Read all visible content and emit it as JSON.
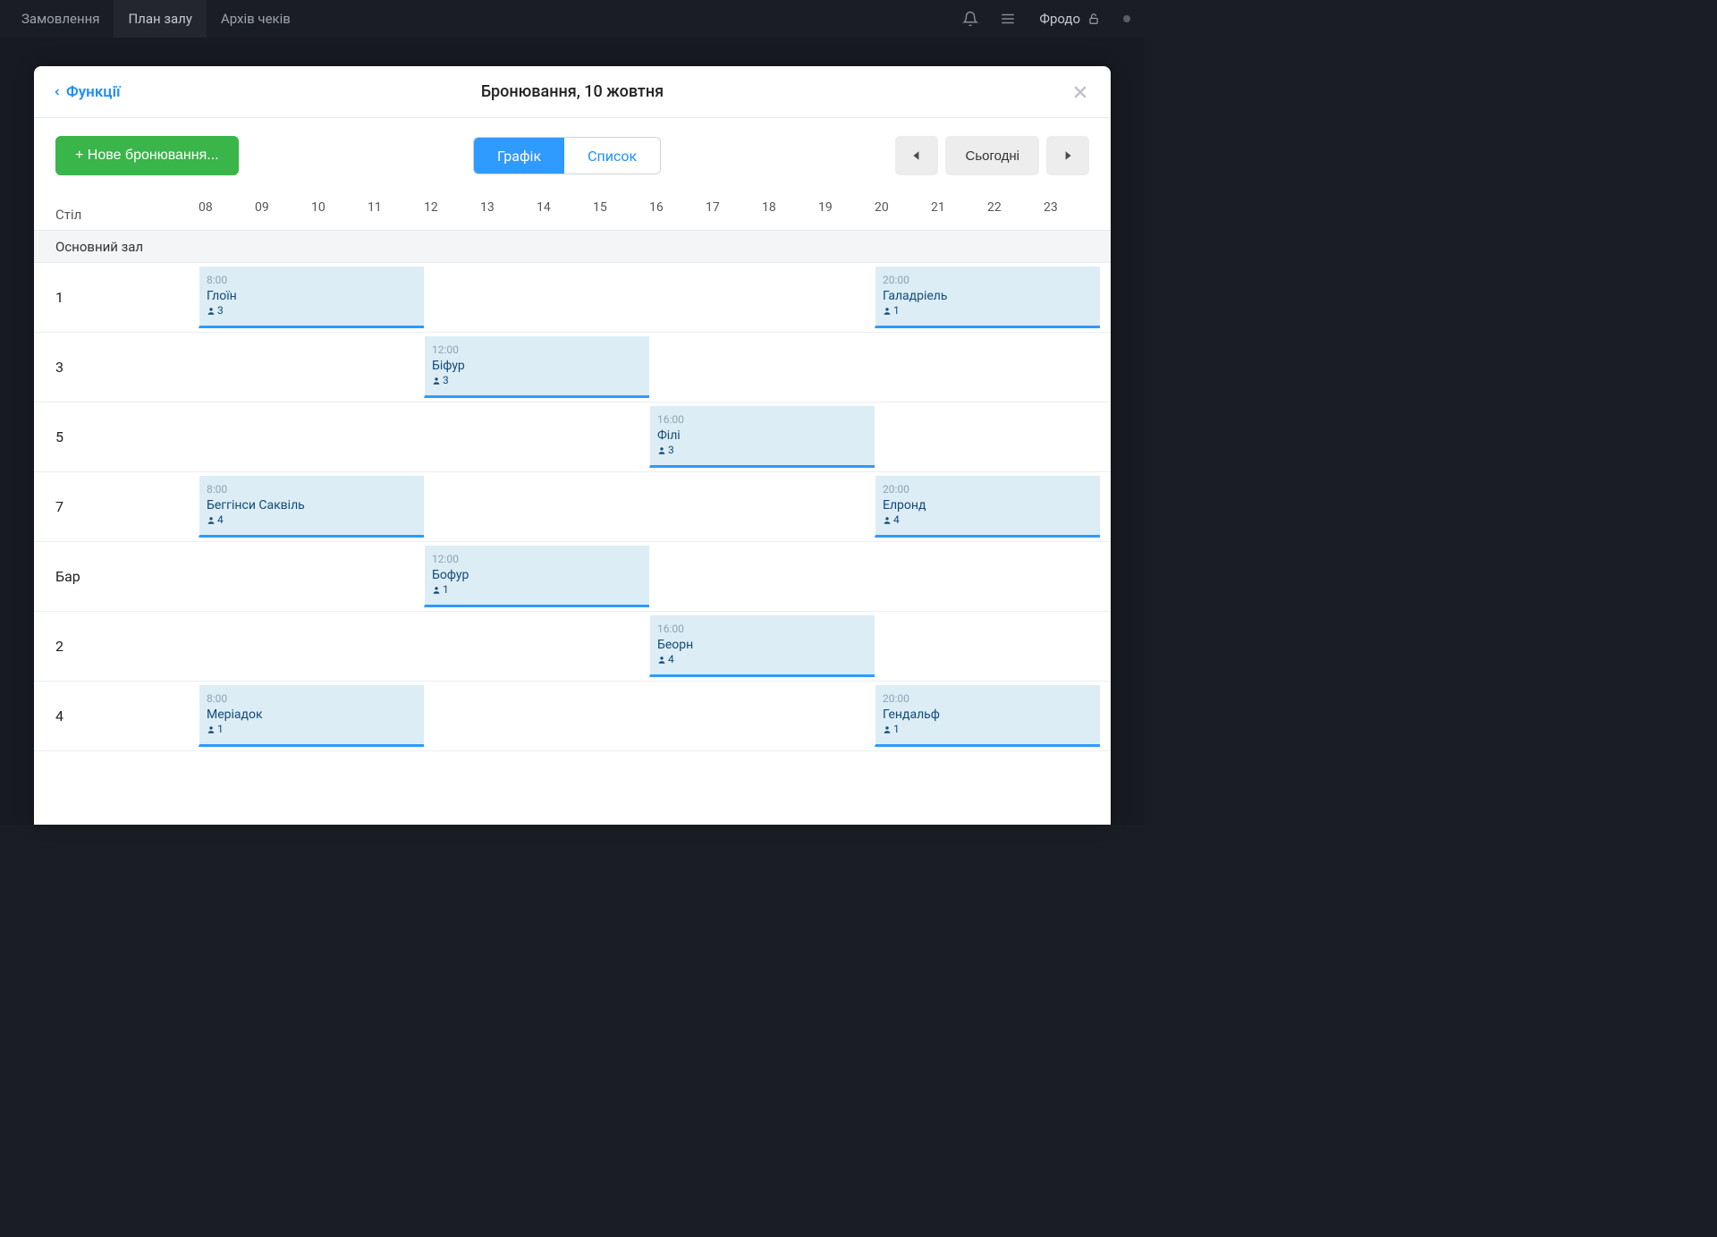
{
  "topbar": {
    "items": [
      "Замовлення",
      "План залу",
      "Архів чеків"
    ],
    "activeIndex": 1,
    "user": "Фродо"
  },
  "modal": {
    "backLabel": "Функції",
    "title": "Бронювання, 10 жовтня",
    "newBookingLabel": "+ Нове бронювання...",
    "segments": {
      "chart": "Графік",
      "list": "Список"
    },
    "todayLabel": "Сьогодні",
    "tableColumnLabel": "Стіл"
  },
  "timeline": {
    "startHour": 8,
    "endHour": 24,
    "hours": [
      "08",
      "09",
      "10",
      "11",
      "12",
      "13",
      "14",
      "15",
      "16",
      "17",
      "18",
      "19",
      "20",
      "21",
      "22",
      "23"
    ]
  },
  "section": {
    "name": "Основний зал"
  },
  "rows": [
    {
      "table": "1",
      "bookings": [
        {
          "time": "8:00",
          "startHour": 8,
          "durationHours": 4,
          "name": "Глоїн",
          "guests": 3
        },
        {
          "time": "20:00",
          "startHour": 20,
          "durationHours": 4,
          "name": "Галадріель",
          "guests": 1
        }
      ]
    },
    {
      "table": "3",
      "bookings": [
        {
          "time": "12:00",
          "startHour": 12,
          "durationHours": 4,
          "name": "Біфур",
          "guests": 3
        }
      ]
    },
    {
      "table": "5",
      "bookings": [
        {
          "time": "16:00",
          "startHour": 16,
          "durationHours": 4,
          "name": "Філі",
          "guests": 3
        }
      ]
    },
    {
      "table": "7",
      "bookings": [
        {
          "time": "8:00",
          "startHour": 8,
          "durationHours": 4,
          "name": "Беггінси Саквіль",
          "guests": 4
        },
        {
          "time": "20:00",
          "startHour": 20,
          "durationHours": 4,
          "name": "Елронд",
          "guests": 4
        }
      ]
    },
    {
      "table": "Бар",
      "bookings": [
        {
          "time": "12:00",
          "startHour": 12,
          "durationHours": 4,
          "name": "Бофур",
          "guests": 1
        }
      ]
    },
    {
      "table": "2",
      "bookings": [
        {
          "time": "16:00",
          "startHour": 16,
          "durationHours": 4,
          "name": "Беорн",
          "guests": 4
        }
      ]
    },
    {
      "table": "4",
      "bookings": [
        {
          "time": "8:00",
          "startHour": 8,
          "durationHours": 4,
          "name": "Меріадок",
          "guests": 1
        },
        {
          "time": "20:00",
          "startHour": 20,
          "durationHours": 4,
          "name": "Гендальф",
          "guests": 1
        }
      ]
    }
  ]
}
